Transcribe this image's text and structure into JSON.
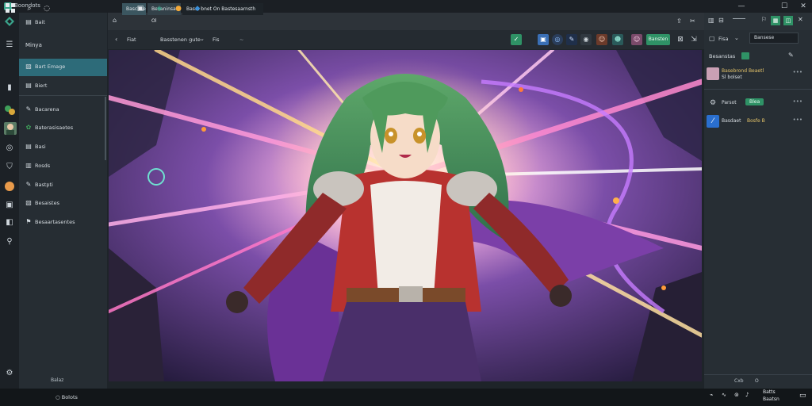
{
  "app": {
    "title": "Boondots"
  },
  "window_controls": {
    "minimize": "—",
    "maximize": "☐",
    "close": "✕"
  },
  "rail": {
    "icons": [
      "logo-icon",
      "menu-icon",
      "panel-icon",
      "tools-icon",
      "avatar-icon",
      "compass-icon",
      "shirt-icon",
      "orange-icon",
      "frame-icon",
      "layers-icon",
      "pin-icon",
      "settings-icon"
    ]
  },
  "sidebar": {
    "top_items": [
      {
        "label": "Bait",
        "icon": "folder-icon"
      },
      {
        "label": "Minya",
        "icon": "grid-icon"
      },
      {
        "label": "Bart Emage",
        "icon": "image-icon"
      },
      {
        "label": "Biert",
        "icon": "list-icon"
      }
    ],
    "items": [
      {
        "label": "Bacarena",
        "icon": "pen-icon"
      },
      {
        "label": "Baterasisaetes",
        "icon": "palette-icon"
      },
      {
        "label": "Basi",
        "icon": "doc-icon"
      },
      {
        "label": "Rosds",
        "icon": "book-icon"
      },
      {
        "label": "Bastpti",
        "icon": "brush-icon"
      },
      {
        "label": "Besaistes",
        "icon": "note-icon"
      },
      {
        "label": "Besaartasentes",
        "icon": "tag-icon"
      }
    ],
    "footer_label": "Balaz"
  },
  "tabs": {
    "items": [
      "Bascbse",
      "Besaninsa Ol",
      "Basst bnet On Bastesaarnsth"
    ],
    "right_icons": [
      "share-icon",
      "tools-icon"
    ]
  },
  "toolbar": {
    "left_labels": [
      "Fiat",
      "Basstenen gute",
      "Fis"
    ],
    "action_button": "Bansten",
    "colors": {
      "accent": "#2f9266",
      "active_tab": "#2d6b79"
    }
  },
  "right_panel": {
    "header_label": "Fisa",
    "search_value": "Bansese",
    "section_label": "Besanstas",
    "rows": [
      {
        "title": "Basebrond Beaetl",
        "sub": "Sl bolset",
        "dots": "•••"
      },
      {
        "title": "Parsot",
        "pill": "Blea",
        "dots": "•••"
      },
      {
        "title": "Basdaet",
        "sub2": "Bosfe B",
        "dots": "•••"
      }
    ],
    "footer": {
      "left": "Cxb",
      "right": "O"
    }
  },
  "taskbar": {
    "search_label": "Bolots",
    "clock_time": "Batts",
    "clock_date": "Baatsn"
  }
}
